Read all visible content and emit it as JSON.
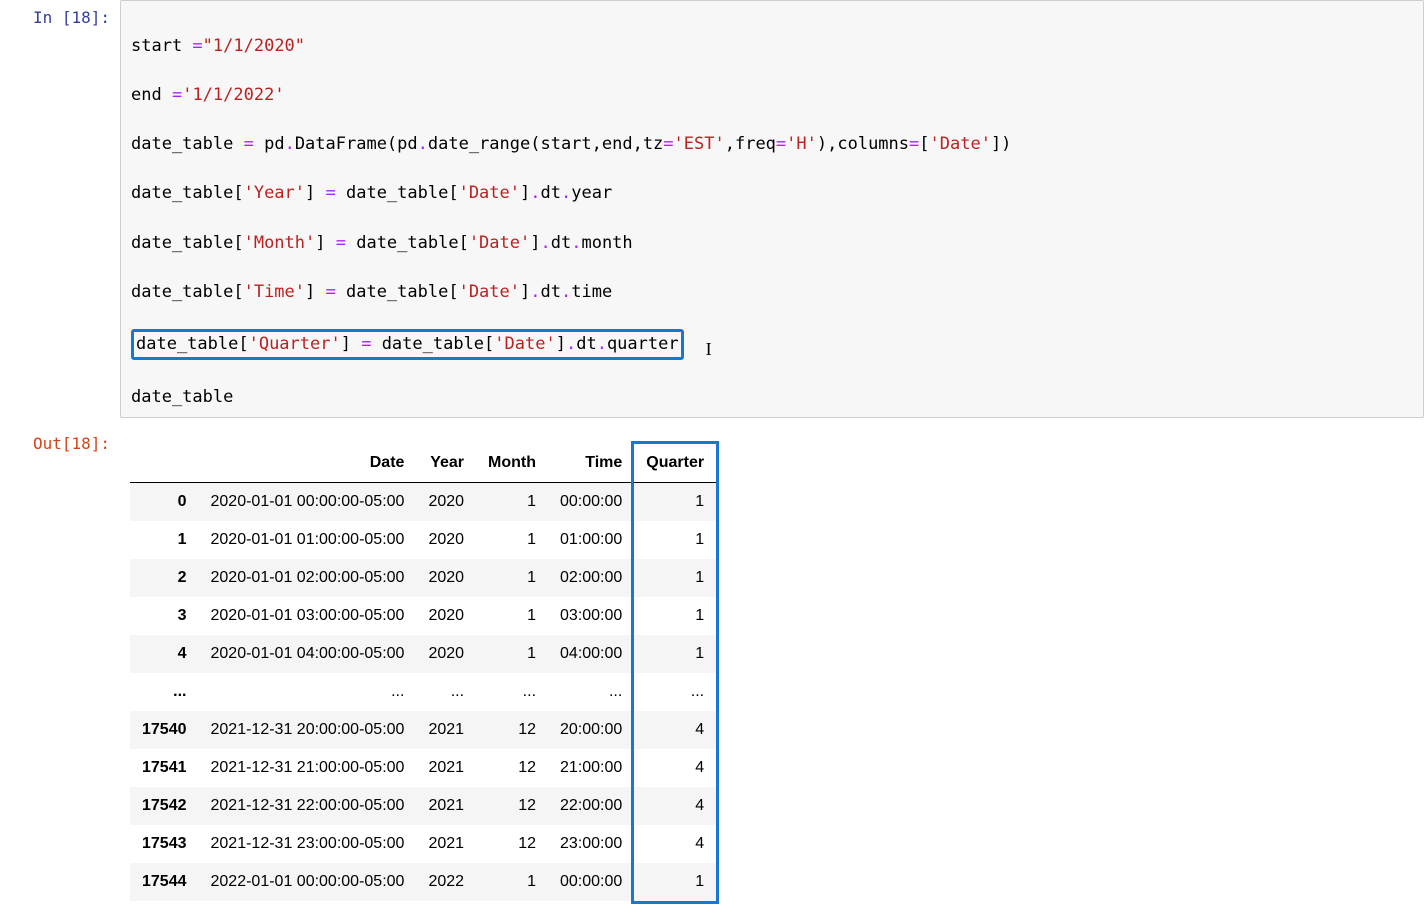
{
  "in_prompt": "In [18]:",
  "out_prompt": "Out[18]:",
  "code": {
    "l1_a": "start ",
    "l1_op": "=",
    "l1_str": "\"1/1/2020\"",
    "l2_a": "end ",
    "l2_op": "=",
    "l2_str": "'1/1/2022'",
    "l3_a": "date_table ",
    "l3_op": "=",
    "l3_b": " pd",
    "l3_dot1": ".",
    "l3_c": "DataFrame(pd",
    "l3_dot2": ".",
    "l3_d": "date_range(start,end,tz",
    "l3_eq": "=",
    "l3_str1": "'EST'",
    "l3_e": ",freq",
    "l3_eq2": "=",
    "l3_str2": "'H'",
    "l3_f": "),columns",
    "l3_eq3": "=",
    "l3_g": "[",
    "l3_str3": "'Date'",
    "l3_h": "])",
    "l4_a": "date_table[",
    "l4_str1": "'Year'",
    "l4_b": "] ",
    "l4_op": "=",
    "l4_c": " date_table[",
    "l4_str2": "'Date'",
    "l4_d": "]",
    "l4_dot": ".",
    "l4_e": "dt",
    "l4_dot2": ".",
    "l4_f": "year",
    "l5_a": "date_table[",
    "l5_str1": "'Month'",
    "l5_b": "] ",
    "l5_op": "=",
    "l5_c": " date_table[",
    "l5_str2": "'Date'",
    "l5_d": "]",
    "l5_dot": ".",
    "l5_e": "dt",
    "l5_dot2": ".",
    "l5_f": "month",
    "l6_a": "date_table[",
    "l6_str1": "'Time'",
    "l6_b": "] ",
    "l6_op": "=",
    "l6_c": " date_table[",
    "l6_str2": "'Date'",
    "l6_d": "]",
    "l6_dot": ".",
    "l6_e": "dt",
    "l6_dot2": ".",
    "l6_f": "time",
    "l7_a": "date_table[",
    "l7_str1": "'Quarter'",
    "l7_b": "] ",
    "l7_op": "=",
    "l7_c": " date_table[",
    "l7_str2": "'Date'",
    "l7_d": "]",
    "l7_dot": ".",
    "l7_e": "dt",
    "l7_dot2": ".",
    "l7_f": "quarter",
    "l8": "date_table"
  },
  "table": {
    "headers": [
      "",
      "Date",
      "Year",
      "Month",
      "Time",
      "Quarter"
    ],
    "rows": [
      {
        "idx": "0",
        "date": "2020-01-01 00:00:00-05:00",
        "year": "2020",
        "month": "1",
        "time": "00:00:00",
        "quarter": "1"
      },
      {
        "idx": "1",
        "date": "2020-01-01 01:00:00-05:00",
        "year": "2020",
        "month": "1",
        "time": "01:00:00",
        "quarter": "1"
      },
      {
        "idx": "2",
        "date": "2020-01-01 02:00:00-05:00",
        "year": "2020",
        "month": "1",
        "time": "02:00:00",
        "quarter": "1"
      },
      {
        "idx": "3",
        "date": "2020-01-01 03:00:00-05:00",
        "year": "2020",
        "month": "1",
        "time": "03:00:00",
        "quarter": "1"
      },
      {
        "idx": "4",
        "date": "2020-01-01 04:00:00-05:00",
        "year": "2020",
        "month": "1",
        "time": "04:00:00",
        "quarter": "1"
      },
      {
        "idx": "...",
        "date": "...",
        "year": "...",
        "month": "...",
        "time": "...",
        "quarter": "..."
      },
      {
        "idx": "17540",
        "date": "2021-12-31 20:00:00-05:00",
        "year": "2021",
        "month": "12",
        "time": "20:00:00",
        "quarter": "4"
      },
      {
        "idx": "17541",
        "date": "2021-12-31 21:00:00-05:00",
        "year": "2021",
        "month": "12",
        "time": "21:00:00",
        "quarter": "4"
      },
      {
        "idx": "17542",
        "date": "2021-12-31 22:00:00-05:00",
        "year": "2021",
        "month": "12",
        "time": "22:00:00",
        "quarter": "4"
      },
      {
        "idx": "17543",
        "date": "2021-12-31 23:00:00-05:00",
        "year": "2021",
        "month": "12",
        "time": "23:00:00",
        "quarter": "4"
      },
      {
        "idx": "17544",
        "date": "2022-01-01 00:00:00-05:00",
        "year": "2022",
        "month": "1",
        "time": "00:00:00",
        "quarter": "1"
      }
    ]
  }
}
